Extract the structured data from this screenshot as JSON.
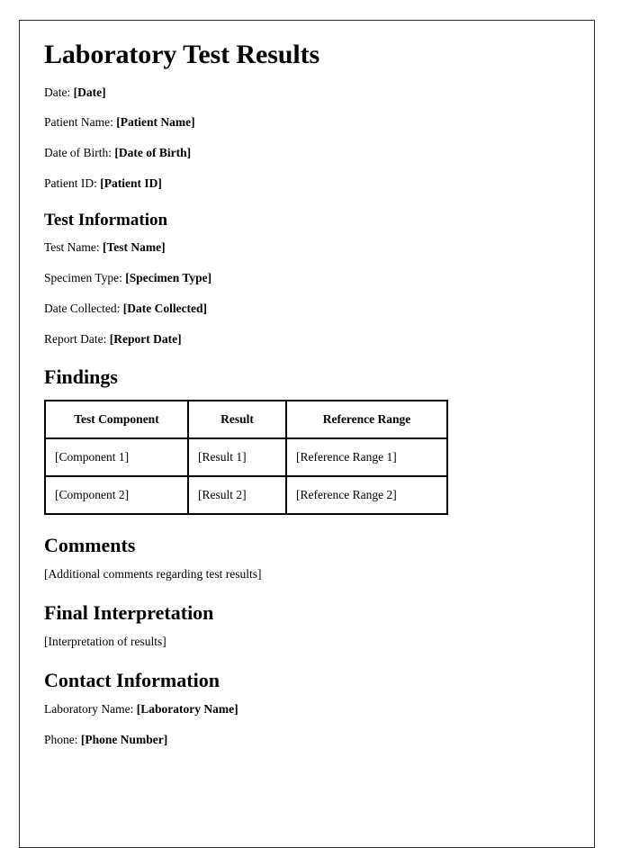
{
  "document": {
    "title": "Laboratory Test Results",
    "header_fields": [
      {
        "label": "Date:",
        "value": "[Date]"
      },
      {
        "label": "Patient Name:",
        "value": "[Patient Name]"
      },
      {
        "label": "Date of Birth:",
        "value": "[Date of Birth]"
      },
      {
        "label": "Patient ID:",
        "value": "[Patient ID]"
      }
    ],
    "test_information": {
      "heading": "Test Information",
      "fields": [
        {
          "label": "Test Name:",
          "value": "[Test Name]"
        },
        {
          "label": "Specimen Type:",
          "value": "[Specimen Type]"
        },
        {
          "label": "Date Collected:",
          "value": "[Date Collected]"
        },
        {
          "label": "Report Date:",
          "value": "[Report Date]"
        }
      ]
    },
    "findings": {
      "heading": "Findings",
      "columns": [
        "Test Component",
        "Result",
        "Reference Range"
      ],
      "rows": [
        [
          "[Component 1]",
          "[Result 1]",
          "[Reference Range 1]"
        ],
        [
          "[Component 2]",
          "[Result 2]",
          "[Reference Range 2]"
        ]
      ]
    },
    "comments": {
      "heading": "Comments",
      "body": "[Additional comments regarding test results]"
    },
    "final_interpretation": {
      "heading": "Final Interpretation",
      "body": "[Interpretation of results]"
    },
    "contact_information": {
      "heading": "Contact Information",
      "fields": [
        {
          "label": "Laboratory Name:",
          "value": "[Laboratory Name]"
        },
        {
          "label": "Phone:",
          "value": "[Phone Number]"
        }
      ]
    }
  },
  "colors": {
    "page_border": "#2b2b2b",
    "text": "#000000",
    "table_border": "#000000",
    "background": "#ffffff"
  }
}
